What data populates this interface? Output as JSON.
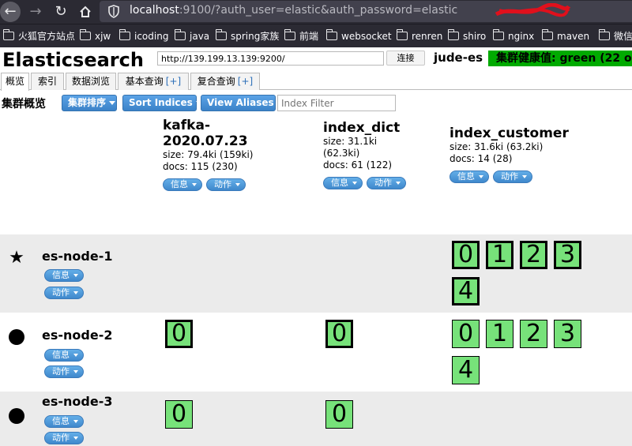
{
  "browser": {
    "url_host": "localhost",
    "url_rest": ":9100/?auth_user=elastic&auth_password=elastic",
    "bookmarks": [
      "火狐官方站点",
      "xjw",
      "icoding",
      "java",
      "spring家族",
      "前端",
      "websocket",
      "renren",
      "shiro",
      "nginx",
      "maven",
      "微信小"
    ]
  },
  "header": {
    "title": "Elasticsearch",
    "connect_url": "http://139.199.13.139:9200/",
    "connect_label": "连接",
    "cluster_name": "jude-es",
    "health_text": "集群健康值: green (22 o"
  },
  "tabs": [
    {
      "label": "概览"
    },
    {
      "label": "索引"
    },
    {
      "label": "数据浏览"
    },
    {
      "label": "基本查询",
      "plus": "[+]"
    },
    {
      "label": "复合查询",
      "plus": "[+]"
    }
  ],
  "toolbar": {
    "title": "集群概览",
    "sort_cluster": "集群排序",
    "sort_indices": "Sort Indices",
    "view_aliases": "View Aliases",
    "filter_placeholder": "Index Filter"
  },
  "indices": [
    {
      "name_line1": "kafka-",
      "name_line2": "2020.07.23",
      "size": "size: 79.4ki (159ki)",
      "docs": "docs: 115 (230)",
      "info": "信息",
      "action": "动作"
    },
    {
      "name_line1": "index_dict",
      "size_line1": "size: 31.1ki",
      "size_line2": "(62.3ki)",
      "docs": "docs: 61 (122)",
      "info": "信息",
      "action": "动作"
    },
    {
      "name_line1": "index_customer",
      "size": "size: 31.6ki (63.2ki)",
      "docs": "docs: 14 (28)",
      "info": "信息",
      "action": "动作"
    }
  ],
  "nodes": [
    {
      "name": "es-node-1",
      "master": true,
      "info": "信息",
      "action": "动作"
    },
    {
      "name": "es-node-2",
      "master": false,
      "info": "信息",
      "action": "动作"
    },
    {
      "name": "es-node-3",
      "master": false,
      "info": "信息",
      "action": "动作"
    }
  ],
  "shards": {
    "node1": {
      "index_customer": [
        "0",
        "1",
        "2",
        "3",
        "4"
      ]
    },
    "node2": {
      "kafka": [
        "0"
      ],
      "index_dict": [
        "0"
      ],
      "index_customer": [
        "0",
        "1",
        "2",
        "3",
        "4"
      ]
    },
    "node3": {
      "kafka": [
        "0"
      ],
      "index_dict": [
        "0"
      ]
    }
  },
  "colors": {
    "health_green": "#00aa00",
    "shard_green": "#77e27a",
    "button_blue": "#3b82c8"
  }
}
